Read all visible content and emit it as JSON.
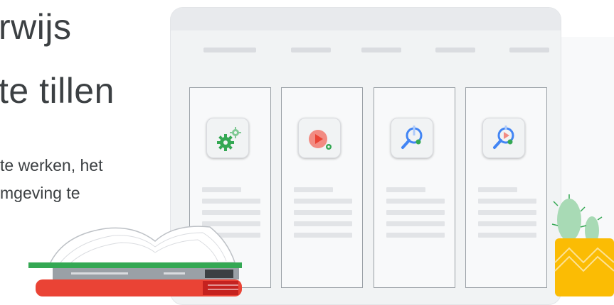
{
  "hero": {
    "headline_line1": "rwijs",
    "headline_line2": "te tillen",
    "body_line1": "te werken, het",
    "body_line2": "mgeving te"
  },
  "illustration": {
    "cards": [
      {
        "icon": "gears-icon"
      },
      {
        "icon": "video-play-icon"
      },
      {
        "icon": "search-insights-icon"
      },
      {
        "icon": "search-video-icon"
      }
    ]
  },
  "colors": {
    "text": "#3c4043",
    "google_green": "#34a853",
    "google_red": "#ea4335",
    "google_blue": "#4285f4",
    "google_yellow": "#fbbc04"
  }
}
